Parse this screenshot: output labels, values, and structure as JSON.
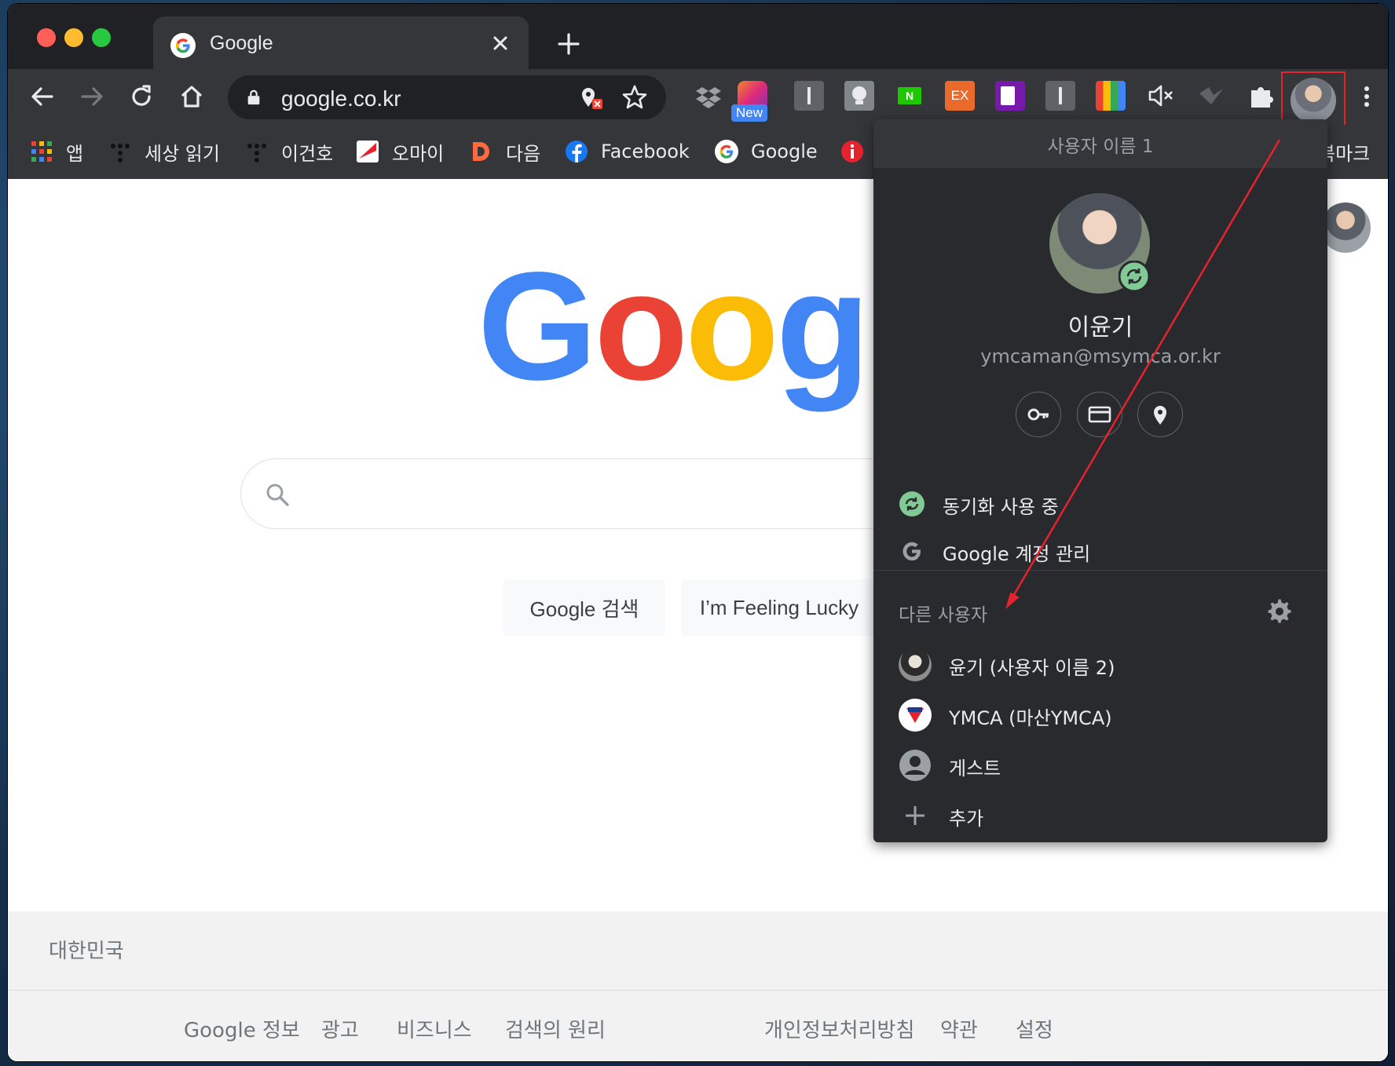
{
  "window": {
    "tab": {
      "title": "Google"
    },
    "omnibox": {
      "url": "google.co.kr"
    },
    "extensions": {
      "new_badge": "New",
      "ex_label": "EX",
      "n_label": "N"
    }
  },
  "bookmarks": {
    "items": [
      {
        "label": "앱"
      },
      {
        "label": "세상 읽기"
      },
      {
        "label": "이건호"
      },
      {
        "label": "오마이"
      },
      {
        "label": "다음"
      },
      {
        "label": "Facebook"
      },
      {
        "label": "Google"
      }
    ],
    "overflow_label": "북마크"
  },
  "page": {
    "buttons": {
      "search": "Google 검색",
      "lucky": "I’m Feeling Lucky"
    },
    "footer": {
      "country": "대한민국",
      "links_left": [
        "Google 정보",
        "광고",
        "비즈니스",
        "검색의 원리"
      ],
      "links_right": [
        "개인정보처리방침",
        "약관",
        "설정"
      ]
    }
  },
  "profile_menu": {
    "header": "사용자 이름 1",
    "name": "이윤기",
    "email": "ymcaman@msymca.or.kr",
    "sync": "동기화 사용 중",
    "manage": "Google 계정 관리",
    "others_title": "다른 사용자",
    "others": [
      {
        "label": "윤기 (사용자 이름 2)"
      },
      {
        "label": "YMCA (마산YMCA)"
      },
      {
        "label": "게스트"
      },
      {
        "label": "추가"
      }
    ]
  },
  "colors": {
    "google_blue": "#4285f4",
    "google_red": "#ea4335",
    "google_yellow": "#fbbc05",
    "google_green": "#34a853",
    "annotation_red": "#e5232f"
  }
}
